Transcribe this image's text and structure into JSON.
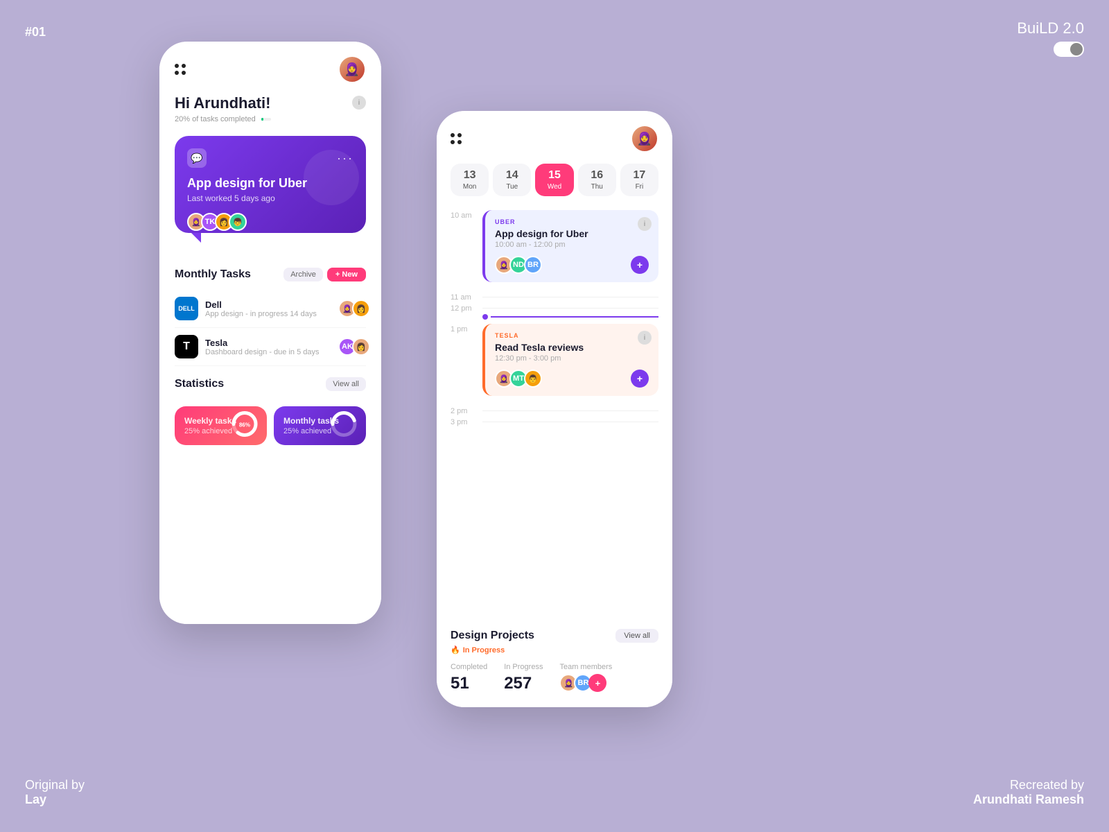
{
  "corner": {
    "top_left": "#01",
    "top_right_title": "BuiLD 2.0",
    "bottom_left_line1": "Original by",
    "bottom_left_line2": "Lay",
    "bottom_right_line1": "Recreated by",
    "bottom_right_line2": "Arundhati Ramesh"
  },
  "phone1": {
    "greeting": "Hi Arundhati!",
    "progress_text": "20% of tasks completed",
    "active_card": {
      "title": "App design for Uber",
      "subtitle": "Last worked 5 days ago",
      "tag_icon": "💬"
    },
    "monthly_tasks": {
      "section_title": "Monthly Tasks",
      "archive_label": "Archive",
      "new_label": "+ New",
      "tasks": [
        {
          "name": "Dell",
          "desc": "App design - in progress 14 days",
          "logo_text": "DELL",
          "logo_bg": "#0076CE",
          "logo_color": "#fff"
        },
        {
          "name": "Tesla",
          "desc": "Dashboard design - due in 5 days",
          "logo_text": "T",
          "logo_bg": "#000",
          "logo_color": "#fff"
        }
      ]
    },
    "statistics": {
      "section_title": "Statistics",
      "view_all_label": "View all",
      "weekly": {
        "label": "Weekly tasks",
        "pct_label": "25% achieved",
        "pct_value": 86
      },
      "monthly": {
        "label": "Monthly tasks",
        "pct_label": "25% achieved",
        "pct_value": 45
      }
    }
  },
  "phone2": {
    "calendar": {
      "days": [
        {
          "num": "13",
          "name": "Mon",
          "active": false
        },
        {
          "num": "14",
          "name": "Tue",
          "active": false
        },
        {
          "num": "15",
          "name": "Wed",
          "active": true
        },
        {
          "num": "16",
          "name": "Thu",
          "active": false
        },
        {
          "num": "17",
          "name": "Fri",
          "active": false
        }
      ]
    },
    "schedule": {
      "time_slots": [
        "10 am",
        "11 am",
        "12 pm",
        "1 pm",
        "2 pm",
        "3 pm"
      ],
      "events": [
        {
          "tag": "UBER",
          "tag_type": "blue",
          "title": "App design for Uber",
          "time": "10:00 am - 12:00 pm"
        },
        {
          "tag": "TESLA",
          "tag_type": "orange",
          "title": "Read Tesla reviews",
          "time": "12:30 pm - 3:00 pm"
        }
      ]
    },
    "design_projects": {
      "title": "Design Projects",
      "view_all": "View all",
      "badge": "In Progress",
      "completed_label": "Completed",
      "completed_num": "51",
      "in_progress_label": "In Progress",
      "in_progress_num": "257",
      "team_label": "Team members"
    }
  }
}
